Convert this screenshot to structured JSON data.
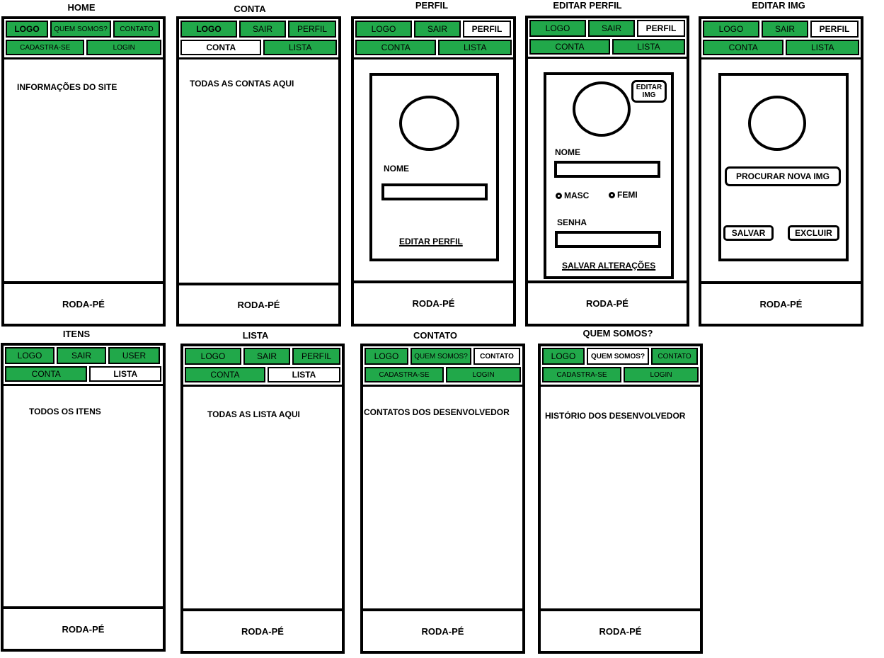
{
  "nav": {
    "logo": "LOGO",
    "quem_somos": "QUEM SOMOS?",
    "contato": "CONTATO",
    "cadastra_se": "CADASTRA-SE",
    "login": "LOGIN",
    "sair": "SAIR",
    "perfil": "PERFIL",
    "conta": "CONTA",
    "lista": "LISTA",
    "user": "USER"
  },
  "footer": "RODA-PÉ",
  "screens": {
    "home": {
      "title": "HOME",
      "content": "INFORMAÇÕES DO SITE"
    },
    "conta": {
      "title": "CONTA",
      "content": "TODAS AS CONTAS AQUI"
    },
    "perfil": {
      "title": "PERFIL",
      "nome_label": "NOME",
      "editar_link": "EDITAR PERFIL"
    },
    "editar_perfil": {
      "title": "EDITAR PERFIL",
      "editar_img": "EDITAR IMG",
      "nome_label": "NOME",
      "masc": "MASC",
      "femi": "FEMI",
      "senha_label": "SENHA",
      "salvar_link": "SALVAR ALTERAÇÕES"
    },
    "editar_img": {
      "title": "EDITAR IMG",
      "procurar": "PROCURAR NOVA IMG",
      "salvar": "SALVAR",
      "excluir": "EXCLUIR"
    },
    "itens": {
      "title": "ITENS",
      "content": "TODOS OS ITENS"
    },
    "lista": {
      "title": "LISTA",
      "content": "TODAS AS LISTA AQUI"
    },
    "contato": {
      "title": "CONTATO",
      "content": "CONTATOS DOS DESENVOLVEDOR"
    },
    "quem_somos": {
      "title": "QUEM SOMOS?",
      "content": "HISTÓRIO DOS DESENVOLVEDOR"
    }
  }
}
